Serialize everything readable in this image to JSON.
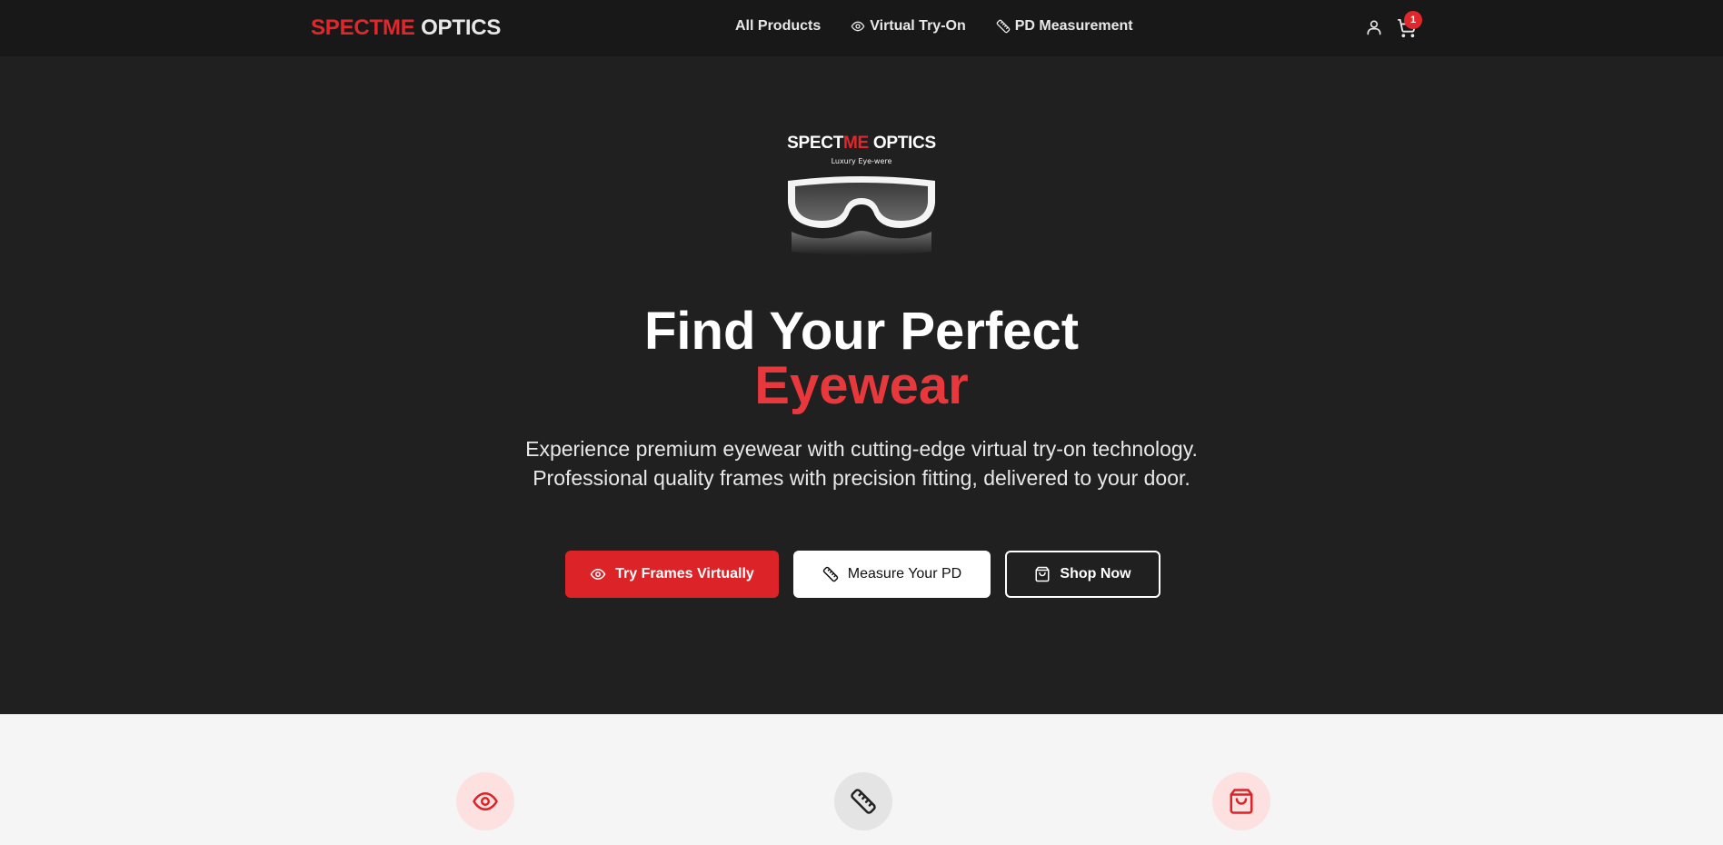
{
  "header": {
    "logo_red": "SPECTME",
    "logo_white": " OPTICS",
    "nav": [
      {
        "label": "All Products",
        "icon": "none"
      },
      {
        "label": "Virtual Try-On",
        "icon": "eye-icon"
      },
      {
        "label": "PD Measurement",
        "icon": "ruler-icon"
      }
    ],
    "cart_count": "1"
  },
  "hero": {
    "brand_title_white_1": "SPECT",
    "brand_title_red": "ME",
    "brand_title_white_2": " OPTICS",
    "brand_subtitle": "Luxury Eye-were",
    "headline_line1": "Find Your Perfect",
    "headline_line2": "Eyewear",
    "description": "Experience premium eyewear with cutting-edge virtual try-on technology. Professional quality frames with precision fitting, delivered to your door.",
    "buttons": {
      "try": "Try Frames Virtually",
      "measure": "Measure Your PD",
      "shop": "Shop Now"
    }
  },
  "features": [
    {
      "icon": "eye-icon"
    },
    {
      "icon": "ruler-icon"
    },
    {
      "icon": "shopping-bag-icon"
    }
  ],
  "colors": {
    "brand_red": "#e0282c",
    "hero_bg": "#202021",
    "nav_bg": "#181818",
    "section_bg": "#f5f5f5"
  }
}
